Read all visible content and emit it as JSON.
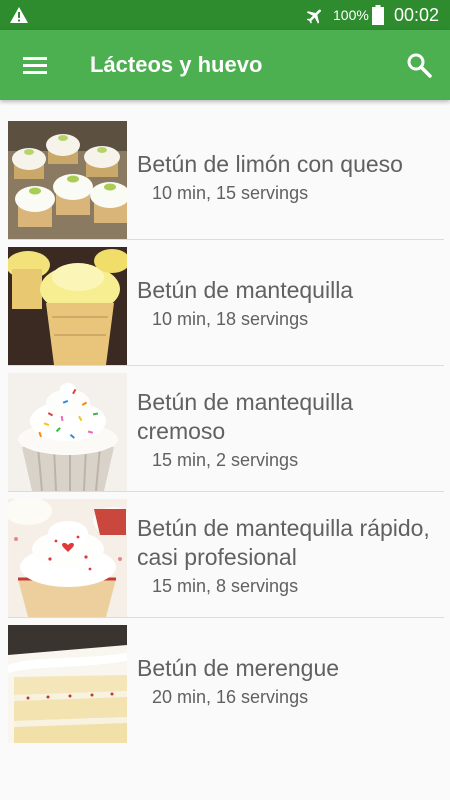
{
  "status_bar": {
    "battery_percent": "100%",
    "time": "00:02",
    "icons": [
      "warning-icon",
      "airplane-mode-icon",
      "battery-icon"
    ]
  },
  "app_bar": {
    "title": "Lácteos y huevo",
    "icons": [
      "menu-icon",
      "search-icon"
    ],
    "color": "#4caf50"
  },
  "recipes": [
    {
      "name": "Betún de limón con queso",
      "meta": "10 min, 15 servings",
      "image": "cupcakes-lime-frosting"
    },
    {
      "name": "Betún de mantequilla",
      "meta": "10 min, 18 servings",
      "image": "cupcakes-yellow-frosting"
    },
    {
      "name": "Betún de mantequilla cremoso",
      "meta": "15 min, 2 servings",
      "image": "cupcake-sprinkles"
    },
    {
      "name": "Betún de mantequilla rápido, casi profesional",
      "meta": "15 min, 8 servings",
      "image": "cupcake-heart-sprinkles"
    },
    {
      "name": "Betún de merengue",
      "meta": "20 min, 16 servings",
      "image": "layer-cake-slice"
    }
  ]
}
